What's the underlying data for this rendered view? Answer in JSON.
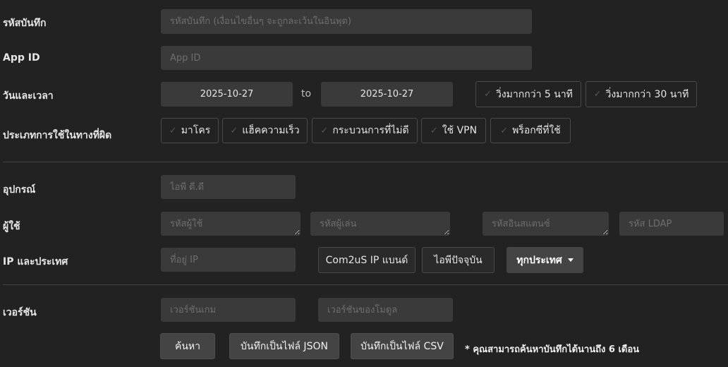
{
  "labels": {
    "record_id": "รหัสบันทึก",
    "app_id": "App ID",
    "date_time": "วันและเวลา",
    "misuse_type": "ประเภทการใช้ในทางที่ผิด",
    "device": "อุปกรณ์",
    "user": "ผู้ใช้",
    "ip_country": "IP และประเทศ",
    "version": "เวอร์ชัน"
  },
  "fields": {
    "record_id_placeholder": "รหัสบันทึก (เงื่อนไขอื่นๆ จะถูกละเว้นในอินพุต)",
    "app_id_placeholder": "App ID",
    "date_from": "2025-10-27",
    "date_to": "2025-10-27",
    "to_text": "to",
    "device_placeholder": "ไอพี ดี.ดี",
    "user_id_placeholder": "รหัสผู้ใช้",
    "player_id_placeholder": "รหัสผู้เล่น",
    "instance_id_placeholder": "รหัสอินสแตนซ์",
    "ldap_placeholder": "รหัส LDAP",
    "ip_placeholder": "ที่อยู่ IP",
    "game_version_placeholder": "เวอร์ชันเกม",
    "module_version_placeholder": "เวอร์ชันของโมดูล"
  },
  "duration_filters": [
    "วิ่งมากกว่า 5 นาที",
    "วิ่งมากกว่า 30 นาที"
  ],
  "misuse_types": [
    "มาโคร",
    "แฮ็คความเร็ว",
    "กระบวนการที่ไม่ดี",
    "ใช้ VPN",
    "พร็อกซีที่ใช้"
  ],
  "ip_buttons": {
    "com2us_ip_band": "Com2uS IP แบนด์",
    "current_ip": "ไอพีปัจจุบัน",
    "country_dropdown": "ทุกประเทศ"
  },
  "actions": {
    "search": "ค้นหา",
    "save_json": "บันทึกเป็นไฟล์ JSON",
    "save_csv": "บันทึกเป็นไฟล์ CSV",
    "note": "* คุณสามารถค้นหาบันทึกได้นานถึง 6 เดือน"
  }
}
